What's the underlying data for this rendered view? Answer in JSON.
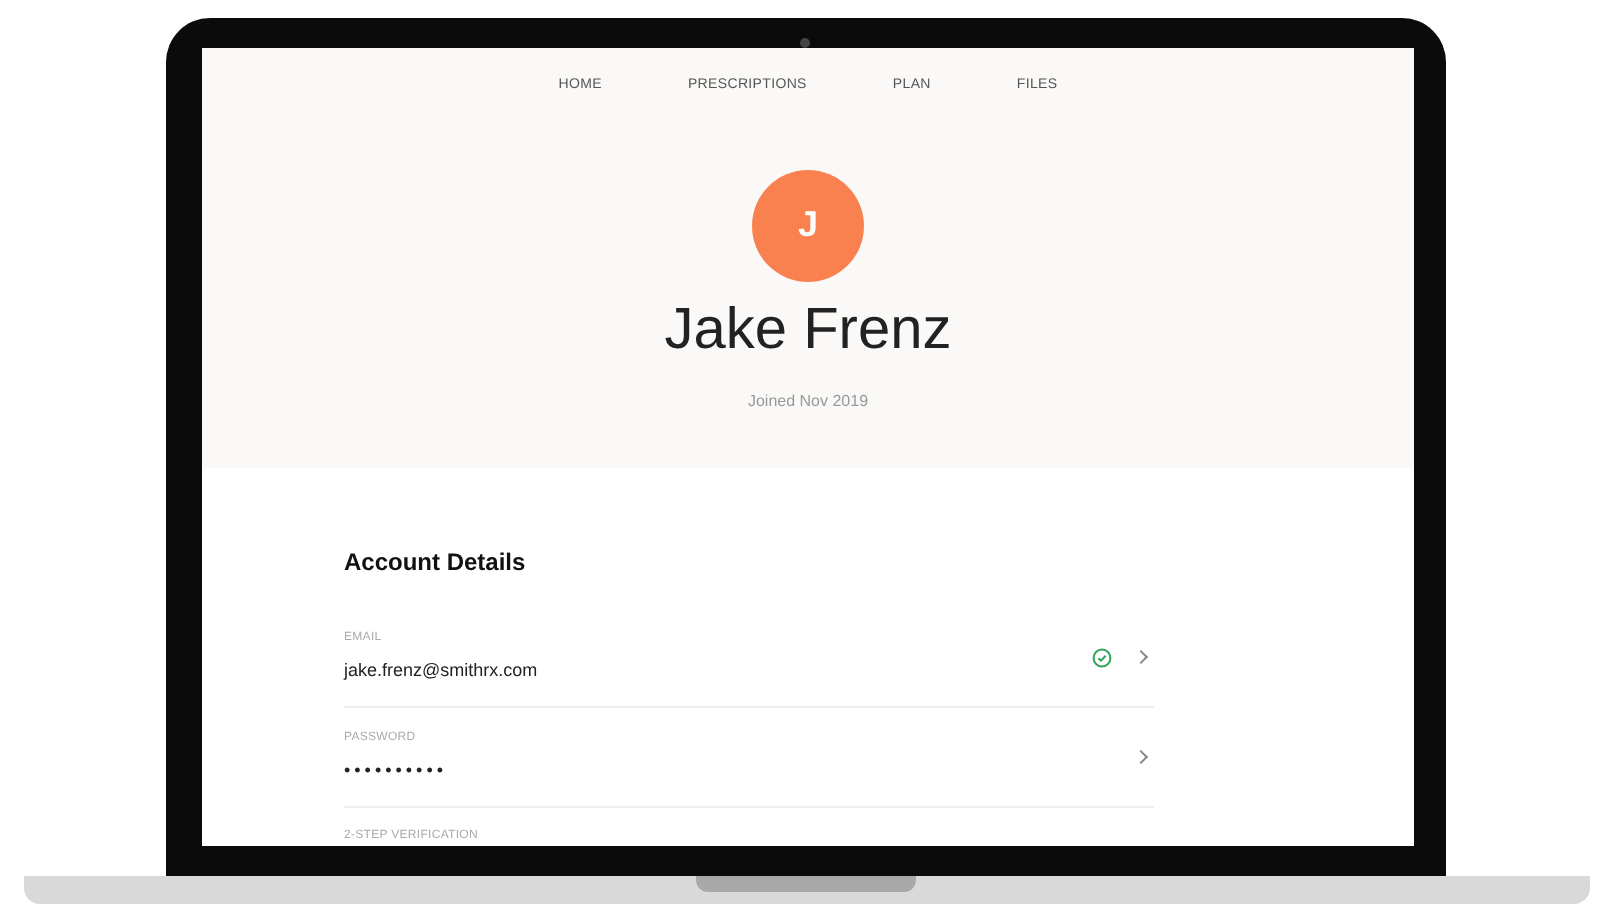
{
  "nav": [
    {
      "label": "HOME"
    },
    {
      "label": "PRESCRIPTIONS"
    },
    {
      "label": "PLAN"
    },
    {
      "label": "FILES"
    }
  ],
  "profile": {
    "initial": "J",
    "name": "Jake Frenz",
    "joined": "Joined Nov 2019"
  },
  "account_details": {
    "title": "Account Details",
    "rows": [
      {
        "label": "EMAIL",
        "value": "jake.frenz@smithrx.com",
        "verified": true
      },
      {
        "label": "PASSWORD",
        "value": "••••••••••",
        "verified": false
      },
      {
        "label": "2-STEP VERIFICATION"
      }
    ]
  }
}
